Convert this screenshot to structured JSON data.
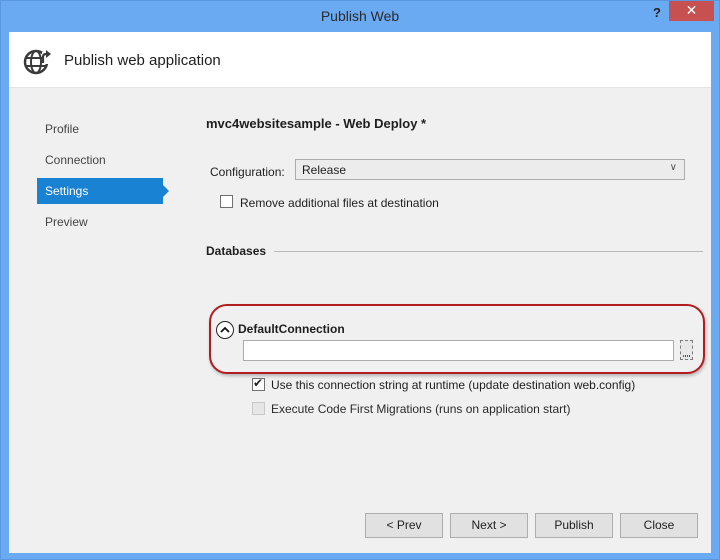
{
  "window": {
    "title": "Publish Web",
    "help_label": "?",
    "close_label": "✕"
  },
  "header": {
    "icon": "globe-publish-icon",
    "title": "Publish web application"
  },
  "nav": {
    "items": [
      {
        "label": "Profile",
        "active": false
      },
      {
        "label": "Connection",
        "active": false
      },
      {
        "label": "Settings",
        "active": true
      },
      {
        "label": "Preview",
        "active": false
      }
    ]
  },
  "settings": {
    "profile_title": "mvc4websitesample - Web Deploy *",
    "configuration_label": "Configuration:",
    "configuration_value": "Release",
    "remove_files_label": "Remove additional files at destination",
    "remove_files_checked": false,
    "databases_heading": "Databases",
    "connection": {
      "name": "DefaultConnection",
      "value": "",
      "expanded": true,
      "use_at_runtime_label": "Use this connection string at runtime (update destination web.config)",
      "use_at_runtime_checked": true,
      "code_first_label": "Execute Code First Migrations (runs on application start)",
      "code_first_checked": false,
      "code_first_enabled": false
    }
  },
  "footer": {
    "prev_label": "< Prev",
    "next_label": "Next >",
    "publish_label": "Publish",
    "close_label": "Close"
  },
  "colors": {
    "titlebar": "#6aaaf2",
    "close_button": "#c75050",
    "nav_active": "#1a82d2",
    "highlight_ring": "#b01c20"
  }
}
